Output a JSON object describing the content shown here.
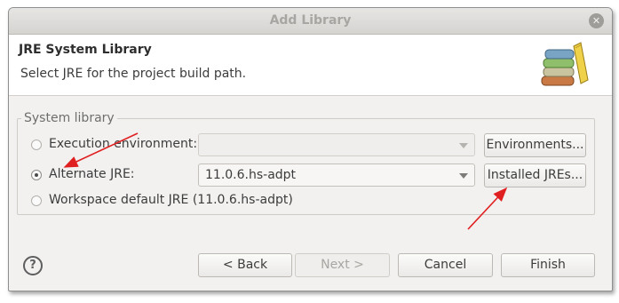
{
  "window": {
    "title": "Add Library",
    "close_icon": "close-icon"
  },
  "header": {
    "title": "JRE System Library",
    "description": "Select JRE for the project build path.",
    "icon": "library-books-icon"
  },
  "system_library": {
    "group_label": "System library",
    "options": [
      {
        "label": "Execution environment:",
        "selected": false,
        "enabled": true
      },
      {
        "label": "Alternate JRE:",
        "selected": true,
        "enabled": true
      },
      {
        "label": "Workspace default JRE (11.0.6.hs-adpt)",
        "selected": false,
        "enabled": true
      }
    ],
    "execution_environment_value": "",
    "alternate_jre_value": "11.0.6.hs-adpt",
    "environments_button": "Environments...",
    "installed_jres_button": "Installed JREs..."
  },
  "footer": {
    "help_icon": "help-icon",
    "help_glyph": "?",
    "back": "< Back",
    "next": "Next >",
    "cancel": "Cancel",
    "finish": "Finish"
  },
  "colors": {
    "annotation_arrow": "#e02020",
    "dialog_bg": "#f2f1f0"
  }
}
